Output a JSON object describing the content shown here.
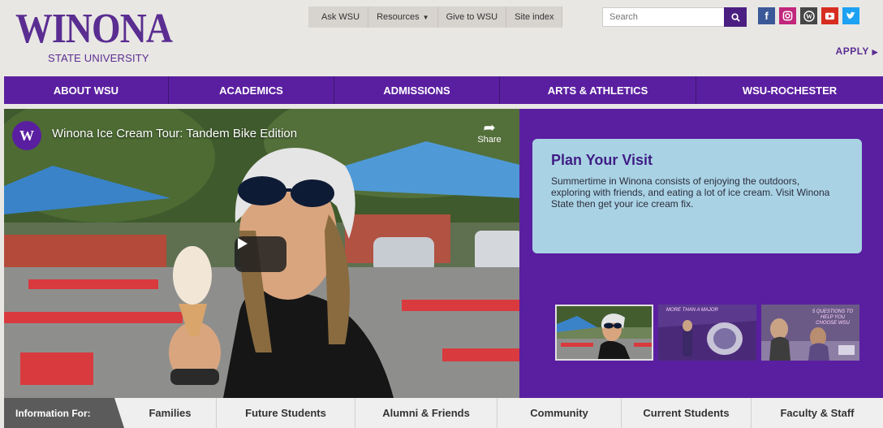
{
  "brand": {
    "logo_main": "WINONA",
    "logo_sub": "STATE UNIVERSITY",
    "accent": "#5a1fa0"
  },
  "utility_nav": [
    {
      "label": "Ask WSU"
    },
    {
      "label": "Resources"
    },
    {
      "label": "Give to WSU"
    },
    {
      "label": "Site index"
    }
  ],
  "search": {
    "placeholder": "Search"
  },
  "social": [
    {
      "icon": "facebook-icon",
      "glyph": "f",
      "color": "#3b5998"
    },
    {
      "icon": "instagram-icon",
      "glyph": "◎",
      "color": "#c1267c"
    },
    {
      "icon": "wordpress-icon",
      "glyph": "W",
      "color": "#464646"
    },
    {
      "icon": "youtube-icon",
      "glyph": "▶",
      "color": "#d62d20"
    },
    {
      "icon": "twitter-icon",
      "glyph": "t",
      "color": "#1da1f2"
    }
  ],
  "apply": "APPLY",
  "main_nav": [
    {
      "label": "ABOUT WSU"
    },
    {
      "label": "ACADEMICS"
    },
    {
      "label": "ADMISSIONS"
    },
    {
      "label": "ARTS & ATHLETICS"
    },
    {
      "label": "WSU-ROCHESTER"
    }
  ],
  "video": {
    "title": "Winona Ice Cream Tour: Tandem Bike Edition",
    "share_label": "Share"
  },
  "visit": {
    "title": "Plan Your Visit",
    "text": "Summertime in Winona consists of enjoying the outdoors, exploring with friends, and eating a lot of ice cream. Visit Winona State then get your ice cream fix."
  },
  "thumbnails": [
    {
      "caption": ""
    },
    {
      "caption": "MORE THAN A MAJOR"
    },
    {
      "caption": "5 QUESTIONS TO HELP YOU CHOOSE WSU"
    }
  ],
  "info_bar": {
    "label": "Information For:",
    "items": [
      {
        "label": "Families"
      },
      {
        "label": "Future Students"
      },
      {
        "label": "Alumni & Friends"
      },
      {
        "label": "Community"
      },
      {
        "label": "Current Students"
      },
      {
        "label": "Faculty & Staff"
      }
    ]
  }
}
